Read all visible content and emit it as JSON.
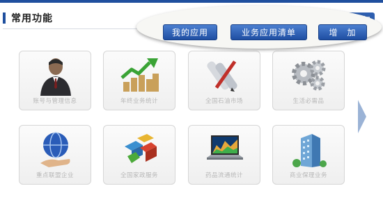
{
  "section": {
    "title": "常用功能"
  },
  "partial_button": {
    "label": "加"
  },
  "popup": {
    "buttons": [
      {
        "label": "我的应用"
      },
      {
        "label": "业务应用清单"
      },
      {
        "label": "增　加"
      }
    ]
  },
  "tiles": [
    {
      "label": "账号与管理信息",
      "icon": "businessman-icon"
    },
    {
      "label": "年终业务统计",
      "icon": "growth-chart-coins-icon"
    },
    {
      "label": "全国石油市场",
      "icon": "blueprint-pencil-icon"
    },
    {
      "label": "生活必需品",
      "icon": "gears-icon"
    },
    {
      "label": "重点联盟企业",
      "icon": "globe-hand-icon"
    },
    {
      "label": "全国家政服务",
      "icon": "puzzle-blocks-icon"
    },
    {
      "label": "药品流通统计",
      "icon": "laptop-chart-icon"
    },
    {
      "label": "商业保理业务",
      "icon": "office-building-icon"
    }
  ],
  "colors": {
    "brand": "#1f4f9e",
    "button": "#2e5fb0",
    "arrow": "#9bb3d6"
  }
}
